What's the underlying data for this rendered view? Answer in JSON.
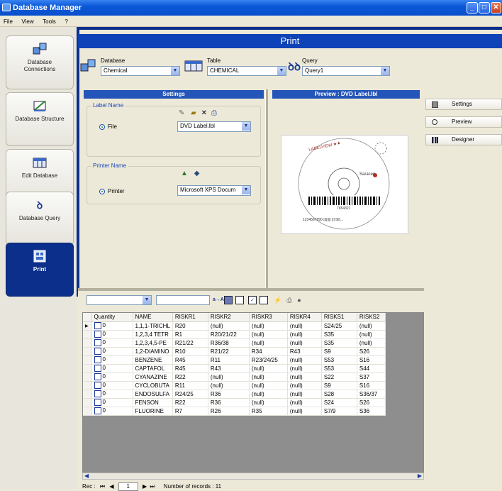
{
  "window": {
    "title": "Database Manager"
  },
  "menu": [
    "File",
    "View",
    "Tools",
    "?"
  ],
  "sidebar": {
    "items": [
      {
        "label": "Database Connections"
      },
      {
        "label": "Database Structure"
      },
      {
        "label": "Edit Database"
      },
      {
        "label": "Database Query"
      },
      {
        "label": "Print"
      }
    ]
  },
  "header": {
    "title": "Print"
  },
  "selectors": {
    "database_label": "Database",
    "database_value": "Chemical",
    "table_label": "Table",
    "table_value": "CHEMICAL",
    "query_label": "Query",
    "query_value": "Query1"
  },
  "settings": {
    "title": "Settings",
    "label_group": "Label Name",
    "file_radio": "File",
    "file_value": "DVD Label.lbl",
    "printer_group": "Printer Name",
    "printer_radio": "Printer",
    "printer_value": "Microsoft XPS Docum"
  },
  "preview": {
    "title": "Preview : DVD Label.lbl",
    "disc_text_top": "LABELVIEW ★★",
    "disc_text_brand": "Saracen",
    "disc_barcode_caption": "7654321",
    "disc_bottom_text": "1234567890  ||||||||  |||  5th..."
  },
  "right_buttons": [
    {
      "label": "Settings",
      "icon": "settings-icon"
    },
    {
      "label": "Preview",
      "icon": "magnifier-icon"
    },
    {
      "label": "Designer",
      "icon": "designer-icon"
    }
  ],
  "grid": {
    "columns": [
      "Quantity",
      "NAME",
      "RISKR1",
      "RISKR2",
      "RISKR3",
      "RISKR4",
      "RISKS1",
      "RISKS2"
    ],
    "rows": [
      [
        "0",
        "1,1,1-TRICHL",
        "R20",
        "(null)",
        "(null)",
        "(null)",
        "S24/25",
        "(null)"
      ],
      [
        "0",
        "1,2,3,4 TETR",
        "R1",
        "R20/21/22",
        "(null)",
        "(null)",
        "S35",
        "(null)"
      ],
      [
        "0",
        "1,2,3,4,5-PE",
        "R21/22",
        "R36/38",
        "(null)",
        "(null)",
        "S35",
        "(null)"
      ],
      [
        "0",
        "1,2-DIAMINO",
        "R10",
        "R21/22",
        "R34",
        "R43",
        "S9",
        "S26"
      ],
      [
        "0",
        "BENZENE",
        "R45",
        "R11",
        "R23/24/25",
        "(null)",
        "S53",
        "S16"
      ],
      [
        "0",
        "CAPTAFOL",
        "R45",
        "R43",
        "(null)",
        "(null)",
        "S53",
        "S44"
      ],
      [
        "0",
        "CYANAZINE",
        "R22",
        "(null)",
        "(null)",
        "(null)",
        "S22",
        "S37"
      ],
      [
        "0",
        "CYCLOBUTA",
        "R11",
        "(null)",
        "(null)",
        "(null)",
        "S9",
        "S16"
      ],
      [
        "0",
        "ENDOSULFA",
        "R24/25",
        "R36",
        "(null)",
        "(null)",
        "S28",
        "S36/37"
      ],
      [
        "0",
        "FENSON",
        "R22",
        "R36",
        "(null)",
        "(null)",
        "S24",
        "S26"
      ],
      [
        "0",
        "FLUORINE",
        "R7",
        "R26",
        "R35",
        "(null)",
        "S7/9",
        "S36"
      ]
    ]
  },
  "navigator": {
    "rec_label": "Rec :",
    "current": "1",
    "count_text": "Number of records : 11"
  }
}
